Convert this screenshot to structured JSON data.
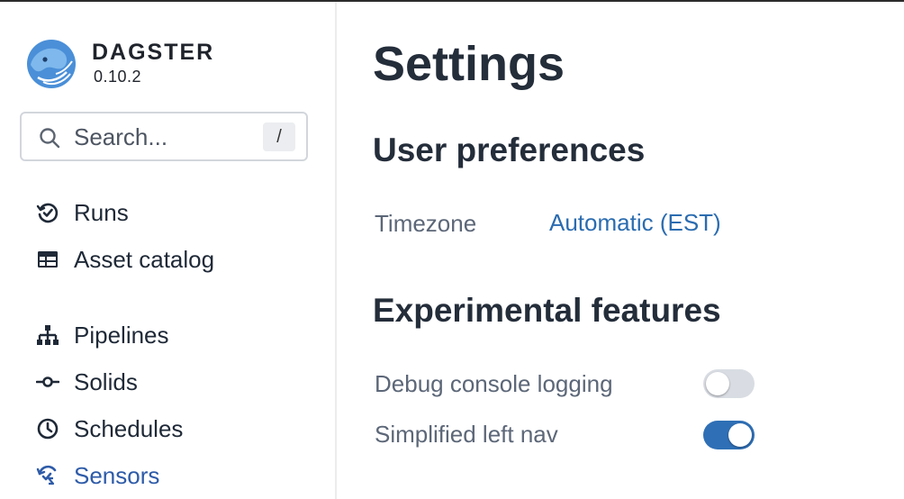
{
  "brand": {
    "name": "DAGSTER",
    "version": "0.10.2"
  },
  "search": {
    "placeholder": "Search...",
    "shortcut": "/"
  },
  "sidebar": {
    "items": [
      {
        "label": "Runs",
        "icon": "history-check-icon"
      },
      {
        "label": "Asset catalog",
        "icon": "table-icon"
      },
      {
        "label": "Pipelines",
        "icon": "hierarchy-icon"
      },
      {
        "label": "Solids",
        "icon": "commit-icon"
      },
      {
        "label": "Schedules",
        "icon": "clock-icon"
      },
      {
        "label": "Sensors",
        "icon": "sensor-icon",
        "active": true
      }
    ]
  },
  "main": {
    "title": "Settings",
    "user_prefs": {
      "heading": "User preferences",
      "timezone_label": "Timezone",
      "timezone_value": "Automatic (EST)"
    },
    "experimental": {
      "heading": "Experimental features",
      "features": [
        {
          "label": "Debug console logging",
          "enabled": false
        },
        {
          "label": "Simplified left nav",
          "enabled": true
        }
      ]
    }
  },
  "colors": {
    "accent": "#2b6cb0",
    "active_nav": "#2e5ba8",
    "toggle_on": "#2f6fb5",
    "toggle_off": "#d9dde3",
    "logo": "#4a8fd8"
  }
}
